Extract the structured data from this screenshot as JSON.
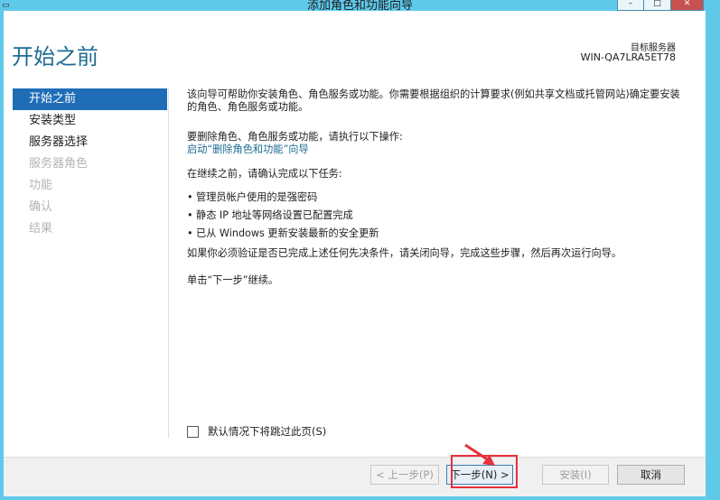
{
  "window": {
    "title": "添加角色和功能向导",
    "icon": "wizard-icon",
    "controls": [
      "minimize-icon",
      "maximize-icon",
      "close-icon"
    ]
  },
  "header": {
    "page_title": "开始之前",
    "target_label": "目标服务器",
    "target_server": "WIN-QA7LRA5ET78"
  },
  "nav": {
    "items": [
      {
        "label": "开始之前",
        "state": "active"
      },
      {
        "label": "安装类型",
        "state": "enabled"
      },
      {
        "label": "服务器选择",
        "state": "enabled"
      },
      {
        "label": "服务器角色",
        "state": "disabled"
      },
      {
        "label": "功能",
        "state": "disabled"
      },
      {
        "label": "确认",
        "state": "disabled"
      },
      {
        "label": "结果",
        "state": "disabled"
      }
    ]
  },
  "content": {
    "intro": "该向导可帮助你安装角色、角色服务或功能。你需要根据组织的计算要求(例如共享文档或托管网站)确定要安装的角色、角色服务或功能。",
    "remove_text": "要删除角色、角色服务或功能，请执行以下操作:",
    "remove_link": "启动“删除角色和功能”向导",
    "before_text": "在继续之前，请确认完成以下任务:",
    "tasks": [
      "管理员帐户使用的是强密码",
      "静态 IP 地址等网络设置已配置完成",
      "已从 Windows 更新安装最新的安全更新"
    ],
    "verify_text": "如果你必须验证是否已完成上述任何先决条件，请关闭向导，完成这些步骤，然后再次运行向导。",
    "click_text": "单击“下一步”继续。"
  },
  "skip": {
    "label": "默认情况下将跳过此页(S)",
    "checked": false
  },
  "buttons": {
    "prev": "< 上一步(P)",
    "next": "下一步(N) >",
    "install": "安装(I)",
    "cancel": "取消"
  },
  "colors": {
    "frame": "#5fc9ea",
    "title_text": "#1d6b93",
    "nav_active": "#1f6db7",
    "annotation": "#e6303b"
  }
}
